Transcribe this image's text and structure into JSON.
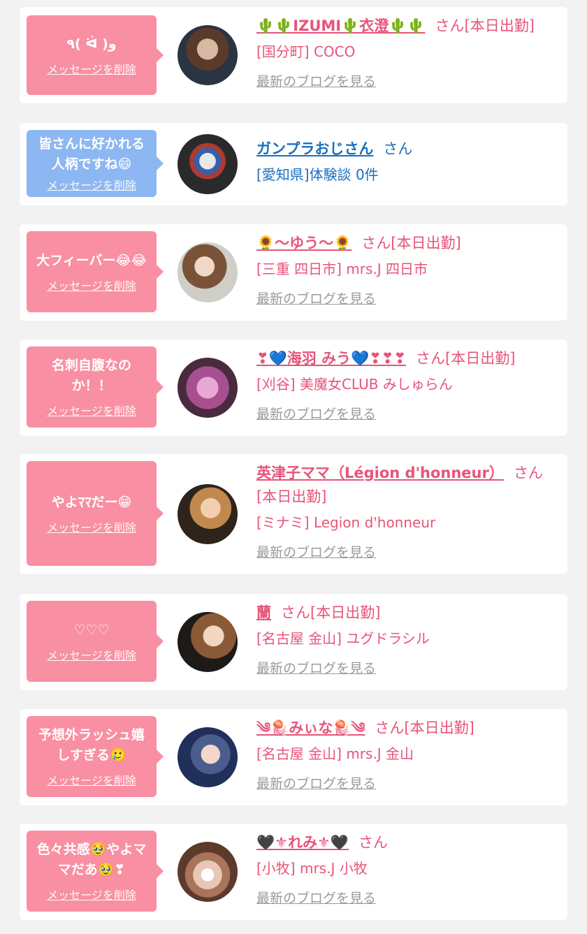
{
  "delete_label": "メッセージを削除",
  "blog_label": "最新のブログを見る",
  "colors": {
    "pink_bubble": "#f98fa2",
    "blue_bubble": "#8db7f2",
    "pink_text": "#e85479",
    "blue_text": "#1b6fbf"
  },
  "entries": [
    {
      "message": "٩( ᐛ )و",
      "name": "🌵🌵IZUMI🌵衣澄🌵🌵",
      "suffix": "さん[本日出勤]",
      "shop": "[国分町] COCO",
      "theme": "pink",
      "has_blog": true
    },
    {
      "message": "皆さんに好かれる人柄ですね😄",
      "name": "ガンプラおじさん",
      "suffix": "さん",
      "shop": "[愛知県]体験談 0件",
      "theme": "blue",
      "has_blog": false
    },
    {
      "message": "大フィーバー😂😂",
      "name": "🌻〜ゆう〜🌻",
      "suffix": "さん[本日出勤]",
      "shop": "[三重 四日市] mrs.J 四日市",
      "theme": "pink",
      "has_blog": true
    },
    {
      "message": "名刺自腹なのか！！",
      "name": "❣💙海羽 みう💙❣❣❣",
      "suffix": "さん[本日出勤]",
      "shop": "[刈谷] 美魔女CLUB みしゅらん",
      "theme": "pink",
      "has_blog": true
    },
    {
      "message": "やよﾏﾏだー😁",
      "name": "英津子ママ（Légion d'honneur）",
      "suffix": "さん[本日出勤]",
      "shop": "[ミナミ] Legion d'honneur",
      "theme": "pink",
      "has_blog": true
    },
    {
      "message": "♡♡♡",
      "name": "蘭",
      "suffix": "さん[本日出勤]",
      "shop": "[名古屋 金山] ユグドラシル",
      "theme": "pink",
      "has_blog": true
    },
    {
      "message": "予想外ラッシュ嬉しすぎる🥲",
      "name": "༄🪼みぃな🪼༄",
      "suffix": "さん[本日出勤]",
      "shop": "[名古屋 金山] mrs.J 金山",
      "theme": "pink",
      "has_blog": true
    },
    {
      "message": "色々共感🥹やよママだあ🥹❣",
      "name": "🖤⚜れみ⚜🖤",
      "suffix": "さん",
      "shop": "[小牧] mrs.J 小牧",
      "theme": "pink",
      "has_blog": true
    }
  ]
}
